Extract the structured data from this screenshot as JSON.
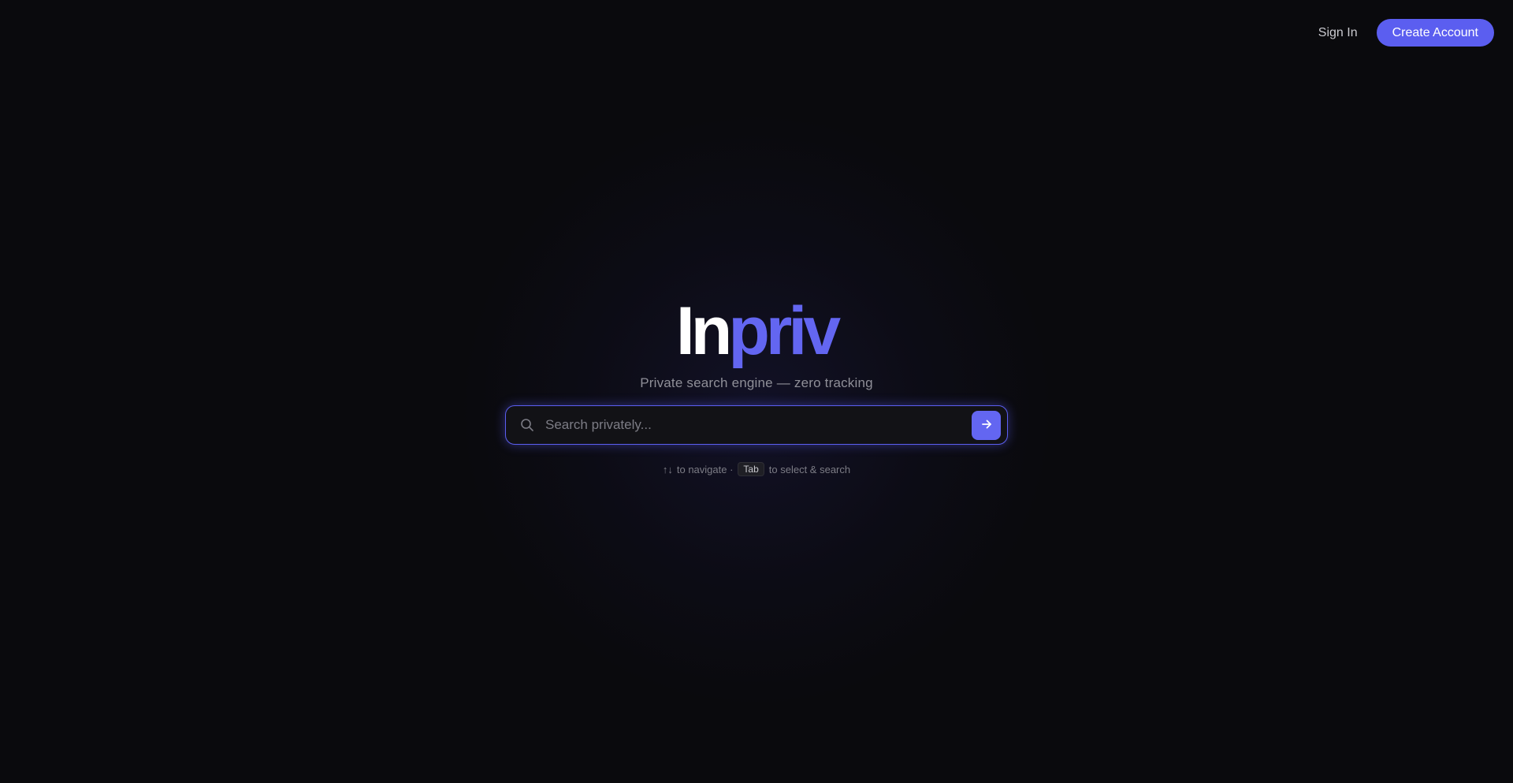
{
  "nav": {
    "sign_in": "Sign In",
    "create_account": "Create Account"
  },
  "logo": {
    "part1": "In",
    "part2": "priv"
  },
  "tagline": "Private search engine — zero tracking",
  "search": {
    "placeholder": "Search privately...",
    "value": "",
    "icon": "search-icon",
    "submit_icon": "arrow-right-icon"
  },
  "hint": {
    "arrows": "↑↓",
    "navigate_text": "to navigate ·",
    "key": "Tab",
    "select_text": "to select & search"
  },
  "colors": {
    "accent": "#6366f1",
    "background": "#0a0a0d"
  }
}
